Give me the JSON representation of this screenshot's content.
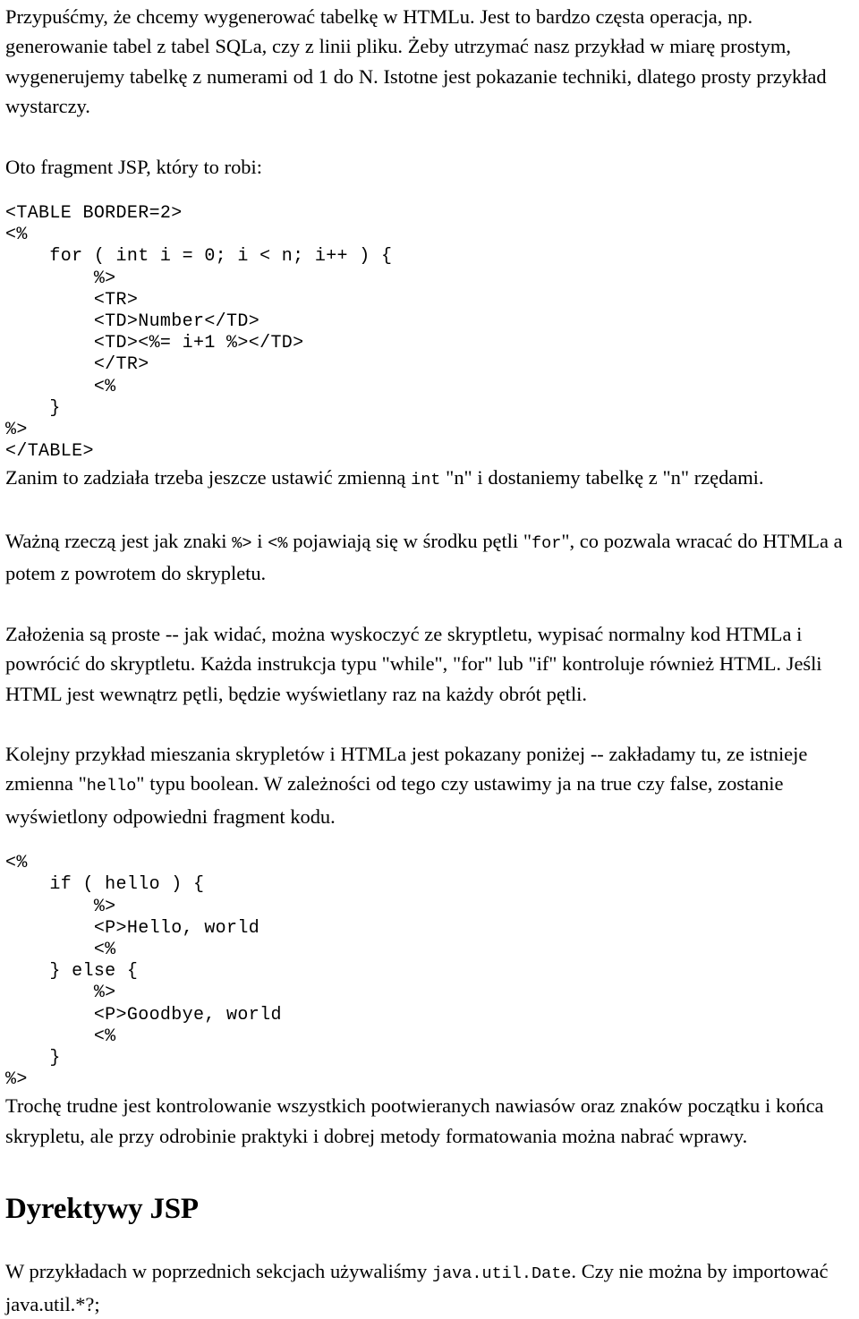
{
  "document": {
    "language": "pl",
    "text_color": "#000000",
    "background_color": "#ffffff"
  },
  "intro_paragraph": {
    "part1": "Przypuśćmy, że chcemy wygenerować tabelkę w HTMLu.  Jest to bardzo częsta operacja, np. generowanie tabel z tabel SQLa, czy z linii pliku.  Żeby utrzymać nasz przykład w miarę prostym, wygenerujemy tabelkę z numerami od 1 do N.  Istotne jest pokazanie techniki, dlatego prosty przykład wystarczy."
  },
  "lead_in": {
    "text": "Oto fragment JSP, który to robi:"
  },
  "code_block_1": {
    "language": "jsp",
    "lines": [
      "<TABLE BORDER=2>",
      "<%",
      "    for ( int i = 0; i < n; i++ ) {",
      "        %>",
      "        <TR>",
      "        <TD>Number</TD>",
      "        <TD><%= i+1 %></TD>",
      "        </TR>",
      "        <%",
      "    }",
      "%>",
      "</TABLE>"
    ]
  },
  "paragraph_zanim": {
    "seg1": "Zanim to zadziała trzeba jeszcze ustawić zmienną ",
    "code1": "int",
    "seg2": " \"n\" i dostaniemy tabelkę z \"n\" rzędami."
  },
  "paragraph_wazna": {
    "seg1": "Ważną rzeczą jest jak znaki ",
    "code1": "%>",
    "seg2": " i ",
    "code2": "<%",
    "seg3": " pojawiają się w środku pętli \"",
    "code3": "for",
    "seg4": "\", co pozwala wracać do HTMLa a potem z powrotem do skrypletu."
  },
  "paragraph_zalozenia": {
    "text": "Założenia są proste -- jak widać, można wyskoczyć ze skryptletu, wypisać normalny kod HTMLa i powrócić do skryptletu.  Każda instrukcja typu \"while\", \"for\" lub \"if\" kontroluje również HTML.  Jeśli HTML jest wewnątrz pętli, będzie wyświetlany raz na każdy obrót pętli."
  },
  "paragraph_kolejny": {
    "seg1": "Kolejny przykład mieszania skrypletów i HTMLa jest pokazany poniżej -- zakładamy tu, ze istnieje zmienna \"",
    "code1": "hello",
    "seg2": "\" typu boolean.  W zależności od tego czy ustawimy ja na true czy false, zostanie wyświetlony odpowiedni fragment kodu."
  },
  "code_block_2": {
    "language": "jsp",
    "lines": [
      "<%",
      "    if ( hello ) {",
      "        %>",
      "        <P>Hello, world",
      "        <%",
      "    } else {",
      "        %>",
      "        <P>Goodbye, world",
      "        <%",
      "    }",
      "%>"
    ]
  },
  "paragraph_troche": {
    "text": "Trochę trudne jest kontrolowanie wszystkich pootwieranych nawiasów oraz znaków początku i końca skrypletu, ale przy odrobinie praktyki i dobrej metody formatowania można nabrać wprawy."
  },
  "section_heading": {
    "text": "Dyrektywy JSP"
  },
  "paragraph_wprzykladach": {
    "seg1": "W przykładach w poprzednich sekcjach używaliśmy ",
    "code1": "java.util.Date",
    "seg2": ". Czy nie można by importować java.util.*?;"
  }
}
